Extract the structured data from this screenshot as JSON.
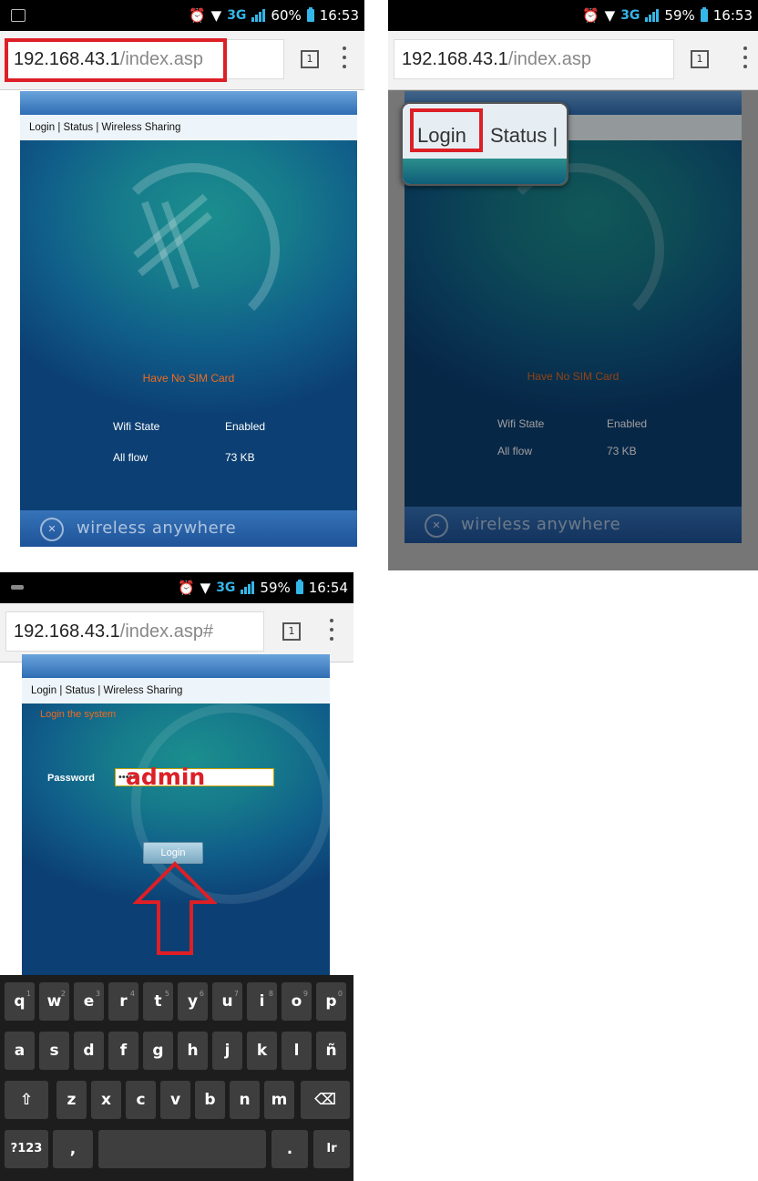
{
  "status": {
    "p1": {
      "network": "3G",
      "battery": "60%",
      "time": "16:53"
    },
    "p2": {
      "network": "3G",
      "battery": "59%",
      "time": "16:53"
    },
    "p3": {
      "network": "3G",
      "battery": "59%",
      "time": "16:54"
    }
  },
  "browser": {
    "p1": {
      "host": "192.168.43.1",
      "path": "/index.asp",
      "tab_count": "1"
    },
    "p2": {
      "host": "192.168.43.1",
      "path": "/index.asp",
      "tab_count": "1"
    },
    "p3": {
      "host": "192.168.43.1",
      "path": "/index.asp#",
      "tab_count": "1"
    }
  },
  "nav": {
    "text": "Login | Status | Wireless Sharing"
  },
  "magnifier": {
    "login": "Login",
    "status": "Status |"
  },
  "home": {
    "sim_message": "Have No SIM Card",
    "rows": [
      {
        "label": "Wifi State",
        "value": "Enabled"
      },
      {
        "label": "All flow",
        "value": "73 KB"
      }
    ]
  },
  "footer": {
    "slogan": "wireless anywhere"
  },
  "login_page": {
    "title": "Login the system",
    "password_label": "Password",
    "password_value": "•••••",
    "annotation": "admin",
    "button": "Login"
  },
  "keyboard": {
    "row1": [
      {
        "k": "q",
        "n": "1"
      },
      {
        "k": "w",
        "n": "2"
      },
      {
        "k": "e",
        "n": "3"
      },
      {
        "k": "r",
        "n": "4"
      },
      {
        "k": "t",
        "n": "5"
      },
      {
        "k": "y",
        "n": "6"
      },
      {
        "k": "u",
        "n": "7"
      },
      {
        "k": "i",
        "n": "8"
      },
      {
        "k": "o",
        "n": "9"
      },
      {
        "k": "p",
        "n": "0"
      }
    ],
    "row2": [
      "a",
      "s",
      "d",
      "f",
      "g",
      "h",
      "j",
      "k",
      "l",
      "ñ"
    ],
    "row3": [
      "z",
      "x",
      "c",
      "v",
      "b",
      "n",
      "m"
    ],
    "row4": {
      "sym": "?123",
      "comma": ",",
      "period": ".",
      "go": "Ir"
    }
  },
  "colors": {
    "highlight": "#dd1f26",
    "accent": "#35b6e8",
    "message": "#f06a1d"
  }
}
